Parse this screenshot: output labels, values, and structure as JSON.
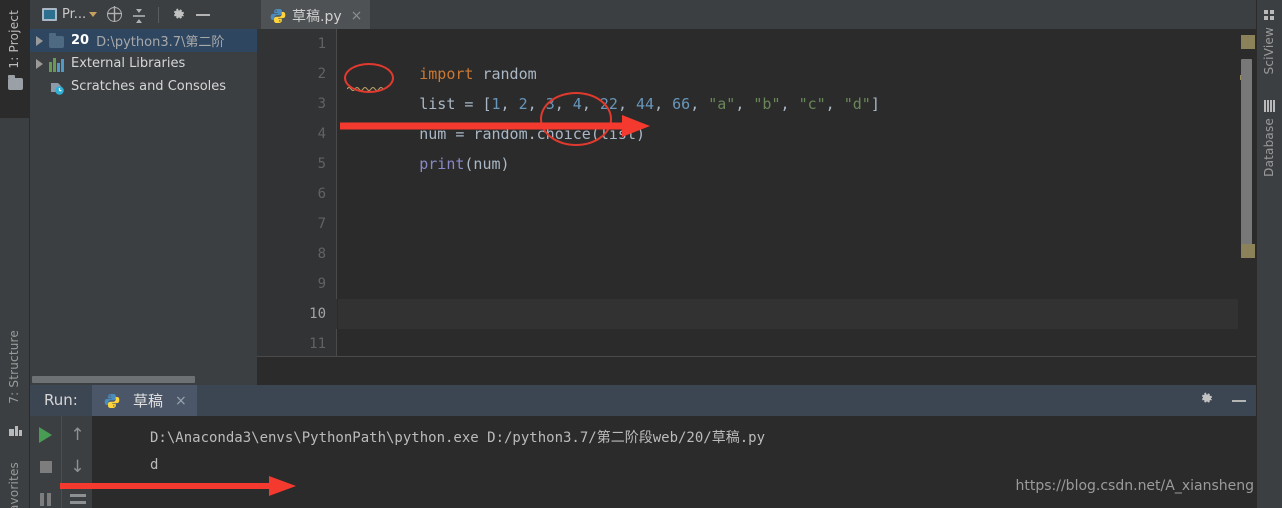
{
  "left_rail": {
    "tabs": [
      {
        "label": "1: Project",
        "name": "project"
      },
      {
        "label": "7: Structure",
        "name": "structure"
      },
      {
        "label": "avorites",
        "name": "favorites"
      }
    ],
    "icons": [
      "folder-icon",
      "structure-squares-icon"
    ]
  },
  "right_rail": {
    "tabs": [
      {
        "label": "SciView",
        "name": "sciview"
      },
      {
        "label": "Database",
        "name": "database"
      }
    ]
  },
  "project_panel": {
    "toolbar": {
      "title": "Pr...",
      "icons": [
        "project-view-icon",
        "locate-target-icon",
        "collapse-all-icon",
        "gear-icon",
        "minimize-icon"
      ]
    },
    "tree": [
      {
        "name": "20",
        "path": "D:\\python3.7\\第二阶",
        "icon": "folder-icon",
        "expandable": true,
        "selected": true
      },
      {
        "name": "External Libraries",
        "path": "",
        "icon": "libraries-icon",
        "expandable": true,
        "selected": false
      },
      {
        "name": "Scratches and Consoles",
        "path": "",
        "icon": "scratches-icon",
        "expandable": false,
        "selected": false
      }
    ]
  },
  "editor": {
    "tab": {
      "title": "草稿.py",
      "icon": "python-file-icon",
      "close": "×"
    },
    "line_numbers": [
      "1",
      "2",
      "3",
      "4",
      "5",
      "6",
      "7",
      "8",
      "9",
      "10",
      "11"
    ],
    "current_line": "10",
    "code": [
      {
        "line": 1,
        "tokens": [
          {
            "t": "import",
            "c": "kw"
          },
          {
            "t": " random",
            "c": "plain"
          }
        ]
      },
      {
        "line": 2,
        "tokens": [
          {
            "t": "list",
            "c": "plain"
          },
          {
            "t": " = [",
            "c": "plain"
          },
          {
            "t": "1",
            "c": "num"
          },
          {
            "t": ", ",
            "c": "plain"
          },
          {
            "t": "2",
            "c": "num"
          },
          {
            "t": ", ",
            "c": "plain"
          },
          {
            "t": "3",
            "c": "num"
          },
          {
            "t": ", ",
            "c": "plain"
          },
          {
            "t": "4",
            "c": "num"
          },
          {
            "t": ", ",
            "c": "plain"
          },
          {
            "t": "22",
            "c": "num"
          },
          {
            "t": ", ",
            "c": "plain"
          },
          {
            "t": "44",
            "c": "num"
          },
          {
            "t": ", ",
            "c": "plain"
          },
          {
            "t": "66",
            "c": "num"
          },
          {
            "t": ", ",
            "c": "plain"
          },
          {
            "t": "\"a\"",
            "c": "str"
          },
          {
            "t": ", ",
            "c": "plain"
          },
          {
            "t": "\"b\"",
            "c": "str"
          },
          {
            "t": ", ",
            "c": "plain"
          },
          {
            "t": "\"c\"",
            "c": "str"
          },
          {
            "t": ", ",
            "c": "plain"
          },
          {
            "t": "\"d\"",
            "c": "str"
          },
          {
            "t": "]",
            "c": "plain"
          }
        ]
      },
      {
        "line": 3,
        "tokens": [
          {
            "t": "num = random.choice(list)",
            "c": "plain"
          }
        ]
      },
      {
        "line": 4,
        "tokens": [
          {
            "t": "print",
            "c": "fn"
          },
          {
            "t": "(num)",
            "c": "plain"
          }
        ]
      }
    ],
    "annotations": [
      {
        "type": "ellipse",
        "target": "list-variable",
        "color": "#e03a2f"
      },
      {
        "type": "ellipse",
        "target": "list-argument",
        "color": "#e03a2f"
      },
      {
        "type": "arrow",
        "target": "editor-pointer",
        "color": "#f4392e"
      }
    ]
  },
  "run_panel": {
    "label": "Run:",
    "tab": {
      "title": "草稿",
      "icon": "python-file-icon",
      "close": "×"
    },
    "header_icons": [
      "gear-icon",
      "minimize-icon"
    ],
    "toolbar_icons": [
      "run-icon",
      "stop-icon",
      "pause-icon",
      "up-arrow-icon",
      "down-arrow-icon",
      "soft-wrap-icon"
    ],
    "console": [
      "D:\\Anaconda3\\envs\\PythonPath\\python.exe D:/python3.7/第二阶段web/20/草稿.py",
      "d"
    ],
    "annotations": [
      {
        "type": "arrow",
        "target": "console-pointer",
        "color": "#f4392e"
      }
    ]
  },
  "watermark": "https://blog.csdn.net/A_xiansheng",
  "colors": {
    "editor_bg": "#2b2b2b",
    "panel_bg": "#3c3f41",
    "gutter_bg": "#313335",
    "selection_blue": "#2f4661",
    "run_header": "#3c4552",
    "keyword_orange": "#cc7832",
    "number_blue": "#6897bb",
    "string_green": "#6a8759",
    "builtin_purple": "#8888c6",
    "text_gray": "#a9b7c6",
    "annotation_red": "#e03a2f"
  }
}
